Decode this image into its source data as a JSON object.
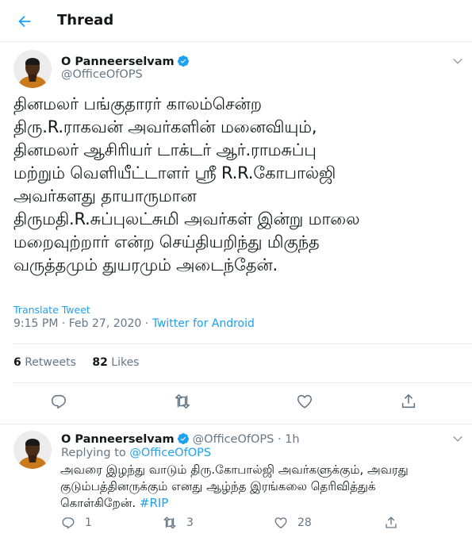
{
  "header": {
    "title": "Thread"
  },
  "tweet": {
    "author_name": "O Panneerselvam",
    "author_handle": "@OfficeOfOPS",
    "lines": [
      "தினமலர் பங்குதாரர் காலம்சென்ற",
      "திரு.R.ராகவன் அவர்களின் மனைவியும்,",
      "தினமலர் ஆசிரியர் டாக்டர் ஆர்.ராமசுப்பு",
      "மற்றும் வெளியீட்டாளர் ஸ்ரீ R.R.கோபால்ஜி",
      "அவர்களது தாயாருமான",
      "திருமதி.R.சுப்புலட்சுமி அவர்கள் இன்று மாலை",
      "மறைவுற்றார் என்ற செய்தியறிந்து மிகுந்த",
      "வருத்தமும் துயரமும் அடைந்தேன்."
    ],
    "translate_label": "Translate Tweet",
    "time": "9:15 PM · Feb 27, 2020 · ",
    "source": "Twitter for Android",
    "retweets_count": "6",
    "retweets_label": "Retweets",
    "likes_count": "82",
    "likes_label": "Likes"
  },
  "reply": {
    "author_name": "O Panneerselvam",
    "author_handle": "@OfficeOfOPS",
    "time": " · 1h",
    "replying_to_label": "Replying to ",
    "replying_to_handle": "@OfficeOfOPS",
    "text_line1": "அவரை இழந்து வாடும் திரு.கோபால்ஜி அவர்களுக்கும், அவரது",
    "text_line2": "குடும்பத்தினருக்கும் எனது ஆழ்ந்த இரங்கலை தெரிவித்துக்",
    "text_line3": "கொள்கிறேன். ",
    "hashtag": "#RIP",
    "reply_count": "1",
    "retweet_count": "3",
    "like_count": "28"
  },
  "colors": {
    "accent": "#1da1f2",
    "secondary_text": "#657786",
    "border": "#e6ecf0"
  },
  "icons": [
    "back-arrow-icon",
    "verified-icon",
    "chevron-down-icon",
    "reply-icon",
    "retweet-icon",
    "like-icon",
    "share-icon"
  ]
}
